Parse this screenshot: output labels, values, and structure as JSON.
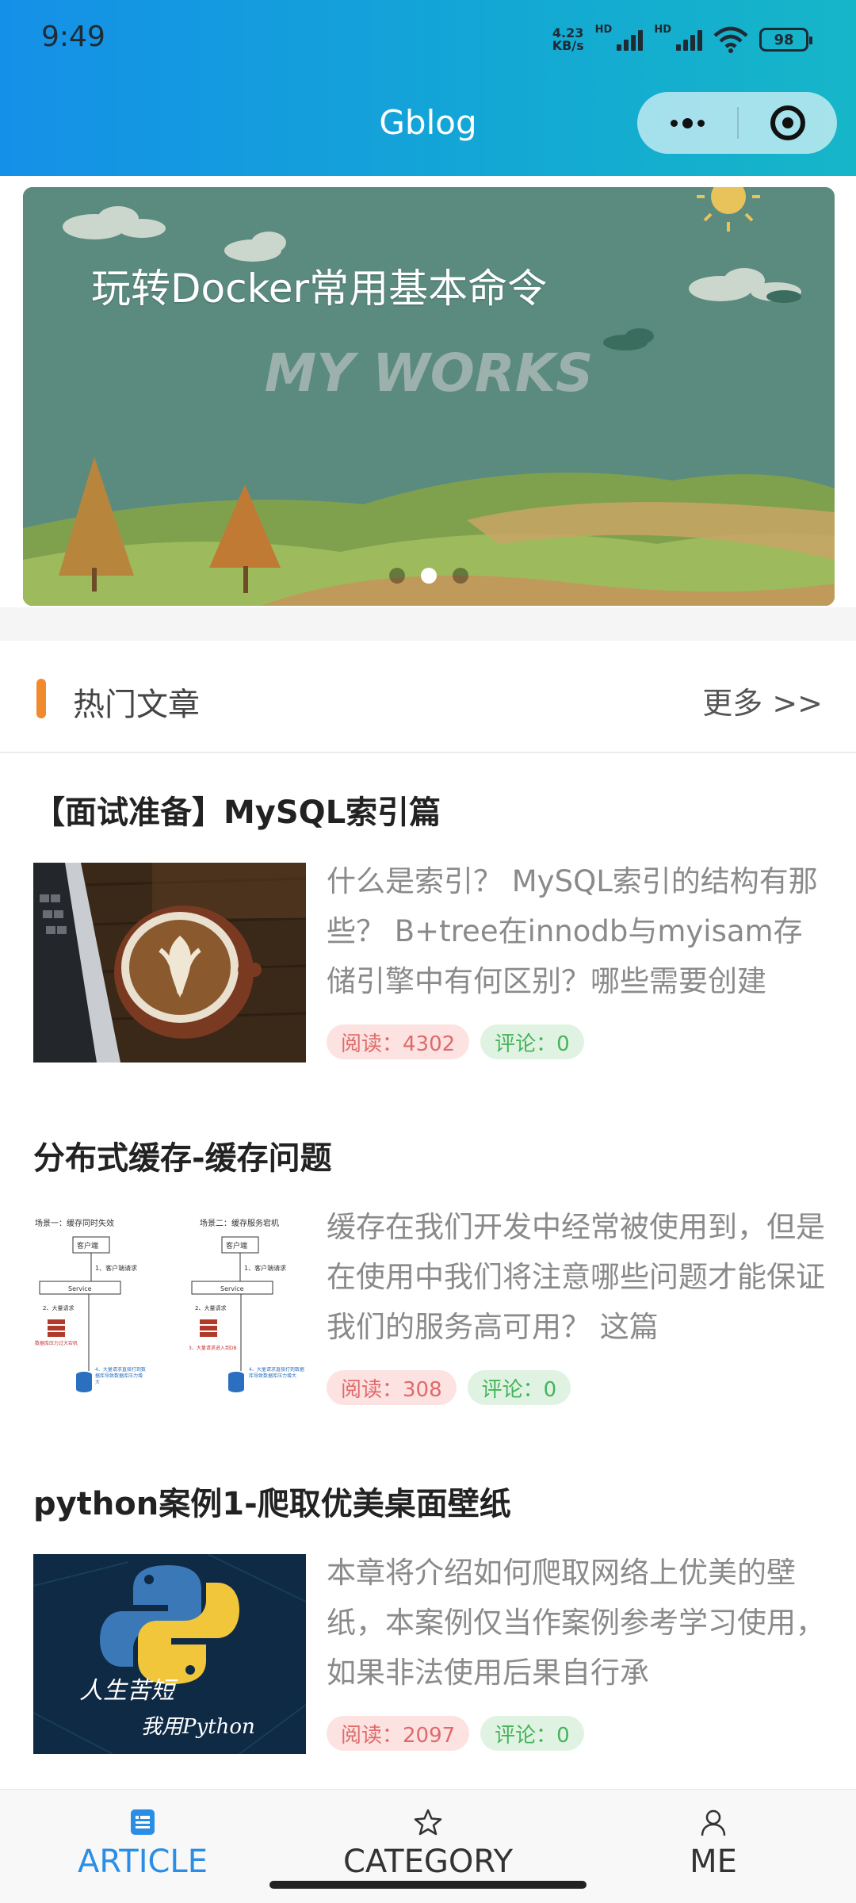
{
  "status_bar": {
    "time": "9:49",
    "net_speed_value": "4.23",
    "net_speed_unit": "KB/s",
    "hd_1": "HD",
    "hd_2": "HD",
    "battery": "98"
  },
  "nav": {
    "title": "Gblog",
    "capsule_more_icon": "more-dots-icon",
    "capsule_close_icon": "target-icon"
  },
  "banner": {
    "title": "玩转Docker常用基本命令",
    "watermark": "MY WORKS",
    "slide_count": 3,
    "active_slide": 2
  },
  "section": {
    "title": "热门文章",
    "more": "更多 >>",
    "accent_color": "#f08a2c"
  },
  "articles": [
    {
      "title": "【面试准备】MySQL索引篇",
      "desc": "什么是索引？ MySQL索引的结构有那些？ B+tree在innodb与myisam存储引擎中有何区别？哪些需要创建",
      "read": "阅读：4302",
      "comment": "评论：0",
      "thumb": "coffee-laptop-image"
    },
    {
      "title": "分布式缓存-缓存问题",
      "desc": "缓存在我们开发中经常被使用到，但是在使用中我们将注意哪些问题才能保证我们的服务高可用？ 这篇",
      "read": "阅读：308",
      "comment": "评论：0",
      "thumb": "cache-diagram-image",
      "thumb_labels": {
        "scene1": "场景一：缓存同时失效",
        "scene2": "场景二：缓存服务宕机",
        "client": "客户端",
        "service": "Service",
        "step1": "1、客户端请求",
        "step2": "2、大量请求",
        "step3": "3、大量请求进入到DB",
        "note": "4、大量请求直接打到数据库导致数据库压力增大",
        "db_down": "数据库压力过大宕机"
      }
    },
    {
      "title": "python案例1-爬取优美桌面壁纸",
      "desc": "本章将介绍如何爬取网络上优美的壁纸，本案例仅当作案例参考学习使用，如果非法使用后果自行承",
      "read": "阅读：2097",
      "comment": "评论：0",
      "thumb": "python-logo-image",
      "thumb_text_1": "人生苦短",
      "thumb_text_2": "我用Python"
    }
  ],
  "tabbar": {
    "items": [
      {
        "label": "ARTICLE",
        "icon": "article-icon",
        "active": true
      },
      {
        "label": "CATEGORY",
        "icon": "star-icon",
        "active": false
      },
      {
        "label": "ME",
        "icon": "user-icon",
        "active": false
      }
    ],
    "active_color": "#2b8ee6"
  }
}
